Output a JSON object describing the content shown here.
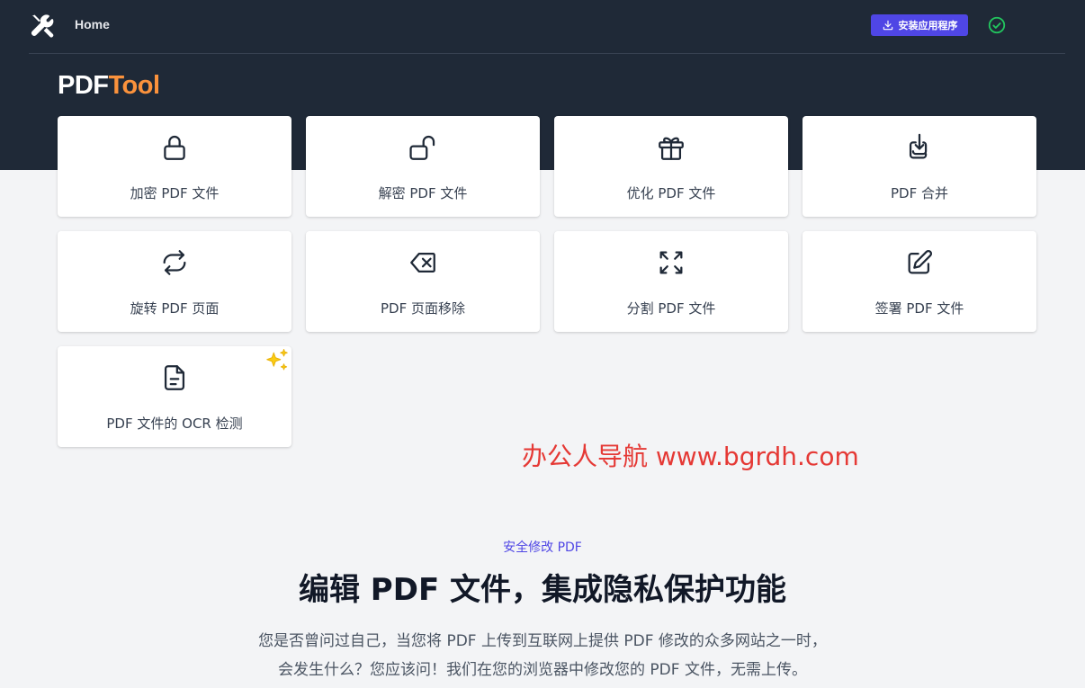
{
  "header": {
    "home_label": "Home",
    "install_label": "安装应用程序",
    "accent_color": "#4f46e5",
    "status_color": "#22c55e",
    "icons": {
      "logo": "wrench-screwdriver-icon",
      "install": "download-icon",
      "status": "check-circle-icon"
    }
  },
  "brand": {
    "part1": "PDF",
    "part2": "Tool",
    "part2_color": "#fb923c"
  },
  "tools": [
    {
      "label": "加密 PDF 文件",
      "icon": "lock-icon"
    },
    {
      "label": "解密 PDF 文件",
      "icon": "unlock-icon"
    },
    {
      "label": "优化 PDF 文件",
      "icon": "gift-icon"
    },
    {
      "label": "PDF 合并",
      "icon": "merge-download-icon"
    },
    {
      "label": "旋转 PDF 页面",
      "icon": "rotate-arrows-icon"
    },
    {
      "label": "PDF 页面移除",
      "icon": "backspace-x-icon"
    },
    {
      "label": "分割 PDF 文件",
      "icon": "expand-arrows-icon"
    },
    {
      "label": "签署 PDF 文件",
      "icon": "pencil-square-icon"
    },
    {
      "label": "PDF 文件的 OCR 检测",
      "icon": "document-text-icon",
      "badge": "sparkles-icon"
    }
  ],
  "watermark": "办公人导航 www.bgrdh.com",
  "section": {
    "eyebrow": "安全修改 PDF",
    "headline": "编辑 PDF 文件，集成隐私保护功能",
    "line1": "您是否曾问过自己，当您将 PDF 上传到互联网上提供 PDF 修改的众多网站之一时，",
    "line2": "会发生什么？您应该问！我们在您的浏览器中修改您的 PDF 文件，无需上传。"
  }
}
